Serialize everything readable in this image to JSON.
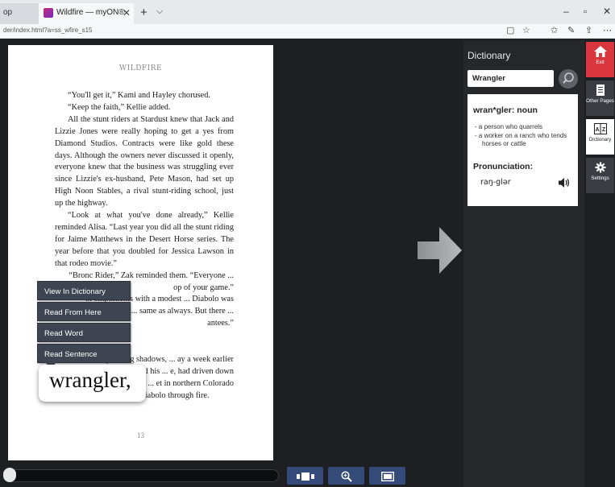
{
  "browser": {
    "tabs": [
      {
        "label": "op"
      },
      {
        "label": "Wildfire — myON®"
      }
    ],
    "url": "der/index.html?a=ss_wfire_s15"
  },
  "book": {
    "running_head": "WILDFIRE",
    "paragraphs": [
      "“You'll get it,” Kami and Hayley chorused.",
      "“Keep the faith,” Kellie added.",
      "All the stunt riders at Stardust knew that Jack and Lizzie Jones were really hoping to get a yes from Diamond Studios. Contracts were like gold these days. Although the owners never discussed it openly, everyone knew that the business was struggling ever since Lizzie's ex-husband, Pete Mason, had set up High Noon Stables, a rival stunt-riding school, just up the highway.",
      "“Look at what you've done already,” Kellie reminded Alisa. “Last year you did all the stunt riding for Jaime Matthews in the Desert Horse series. The year before that you doubled for Jessica Lawson in that rodeo movie.”",
      "“Bronc Rider,” Zak reminded them. “Everyone ... op of your game.”",
      "... ompliments with a modest ... Diabolo was fantastic at the ... same as always. But there ... antees.”",
      "... e lengthening shadows, ... ay a week earlier when ... ike Peterson, and his ... e, had driven down to ... et in northern Colorado",
      "especially to see her ride Diabolo through fire."
    ],
    "page_number": "13",
    "selected_word": "wrangler,"
  },
  "context_menu": {
    "items": [
      "View In Dictionary",
      "Read From Here",
      "Read Word",
      "Read Sentence"
    ]
  },
  "dictionary": {
    "title": "Dictionary",
    "search_value": "Wrangler",
    "entry": "wran*gler: noun",
    "definitions": [
      "a person who quarrels",
      "a worker on a ranch who tends horses or cattle"
    ],
    "pronunciation_label": "Pronunciation:",
    "pronunciation": "raŋ-glər"
  },
  "tools": [
    {
      "label": "Exit",
      "icon": "home-icon",
      "color": "#d9363e"
    },
    {
      "label": "Other Pages",
      "icon": "pages-icon",
      "color": "#3a3d44"
    },
    {
      "label": "Dictionary",
      "icon": "dictionary-icon",
      "color": "#ffffff"
    },
    {
      "label": "Settings",
      "icon": "gear-icon",
      "color": "#3a3d44"
    }
  ],
  "reading_progress": 0
}
